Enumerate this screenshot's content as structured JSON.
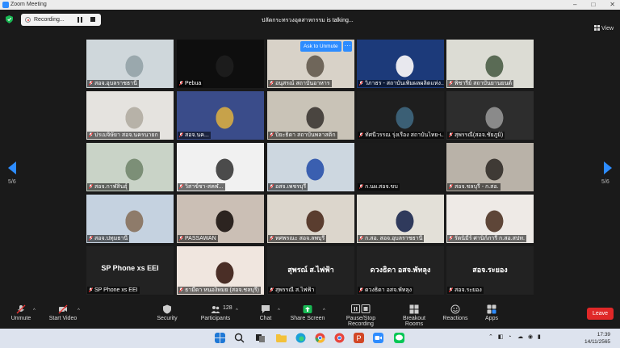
{
  "window": {
    "title": "Zoom Meeting",
    "controls": [
      "–",
      "□",
      "✕"
    ]
  },
  "recording": {
    "label": "Recording..."
  },
  "speaker_banner": "ปลัดกระทรวงอุตสาหกรรม is talking...",
  "view_button": "View",
  "pagination": {
    "left": "5/6",
    "right": "5/6"
  },
  "overlay": {
    "ask_unmute": "Ask to Unmute",
    "more": "···"
  },
  "participants": [
    {
      "name": "สอจ.อุบลราชธานี"
    },
    {
      "name": "Pebua"
    },
    {
      "name": "อนุสรณ์ สถาบันอาหาร"
    },
    {
      "name": "วิภาธร - สถาบันเพิ่มผลผลิตแห่ง..."
    },
    {
      "name": "พิชารีย์ สถาบันยานยนต์"
    },
    {
      "name": "ปรเมจิษัยา สอจ.นครนายก"
    },
    {
      "name": "สอจ.นค..."
    },
    {
      "name": "ปิยะธิดา สถาบันพลาสติก"
    },
    {
      "name": "ทัศนีวรรณ รุ่งเรือง สถาบันไทย-เ..."
    },
    {
      "name": "สุพรรณี(สอจ.ชัยภูมิ)"
    },
    {
      "name": "สอจ.กาฬสินธุ์"
    },
    {
      "name": "วิสาข์ชา-สคฬ..."
    },
    {
      "name": "อสจ.เพชรบุรี"
    },
    {
      "name": "ก.นผ.สอจ.ขบ"
    },
    {
      "name": "สอจ.ชลบุรี - ก.สอ."
    },
    {
      "name": "สอจ.ปทุมธานี"
    },
    {
      "name": "PASSAWAN"
    },
    {
      "name": "ทศพรณะ สอจ.ลพบุรี"
    },
    {
      "name": "ก.สอ. สอจ.อุบลราชธานี"
    },
    {
      "name": "รัตนิมีร์ ศานิก์ภารี ก.สอ.สปท."
    },
    {
      "name": "SP Phone xs EEI",
      "display": "SP Phone xs EEI"
    },
    {
      "name": "ธามีดา หนองิหมย (สอจ.ชลบุรี)"
    },
    {
      "name": "สุพรรณี ส.ไฟฟ้า",
      "display": "สุพรณ์ ส.ไฟฟ้า"
    },
    {
      "name": "ดวงธิดา อสจ.พัทลุง",
      "display": "ดวงธิดา อสจ.พัทลุง"
    },
    {
      "name": "สอจ.ระยอง",
      "display": "สอจ.ระยอง"
    }
  ],
  "toolbar": {
    "unmute": "Unmute",
    "start_video": "Start Video",
    "security": "Security",
    "participants": "Participants",
    "participants_count": "128",
    "chat": "Chat",
    "share_screen": "Share Screen",
    "recording": "Pause/Stop Recording",
    "breakout": "Breakout Rooms",
    "reactions": "Reactions",
    "apps": "Apps",
    "leave": "Leave"
  },
  "taskbar": {
    "time": "17:39",
    "date": "14/11/2565"
  },
  "colors": {
    "accent": "#2d8cff",
    "leave": "#e02828",
    "share": "#19b954",
    "speaker_border": "#8ccc3b"
  }
}
